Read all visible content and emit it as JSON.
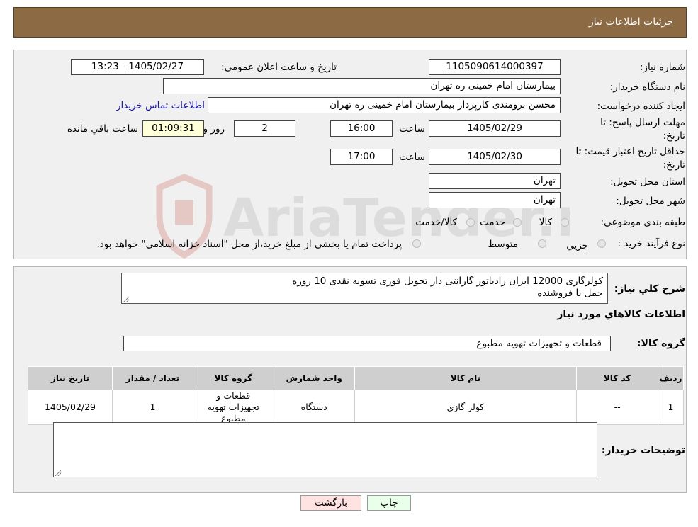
{
  "header": {
    "title": "جزئیات اطلاعات نیاز"
  },
  "watermark": {
    "text": "AriaTender.neT"
  },
  "form": {
    "need_number": {
      "label": "شماره نیاز:",
      "value": "1105090614000397"
    },
    "announce": {
      "label": "تاریخ و ساعت اعلان عمومی:",
      "value": "1405/02/27 - 13:23"
    },
    "buyer_org": {
      "label": "نام دستگاه خریدار:",
      "value": "بیمارستان امام خمینی ره  تهران"
    },
    "requester": {
      "label": "ایجاد کننده درخواست:",
      "value": "محسن برومندی کارپرداز بیمارستان امام خمینی ره  تهران",
      "contact_link": "اطلاعات تماس خریدار"
    },
    "reply_deadline": {
      "label_line1": "مهلت ارسال پاسخ: تا",
      "label_line2": "تاریخ:",
      "date": "1405/02/29",
      "time_label": "ساعت",
      "time": "16:00",
      "days": "2",
      "days_label": "روز و",
      "remaining": "01:09:31",
      "remaining_label": "ساعت باقي مانده"
    },
    "price_validity": {
      "label_line1": "حداقل تاریخ اعتبار قیمت: تا",
      "label_line2": "تاریخ:",
      "date": "1405/02/30",
      "time_label": "ساعت",
      "time": "17:00"
    },
    "province": {
      "label": "استان محل تحویل:",
      "value": "تهران"
    },
    "city": {
      "label": "شهر محل تحویل:",
      "value": "تهران"
    },
    "category": {
      "label": "طبقه بندی موضوعی:",
      "options": [
        "کالا",
        "خدمت",
        "کالا/خدمت"
      ]
    },
    "purchase_type": {
      "label": "نوع فرآیند خرید :",
      "options": [
        "جزیي",
        "متوسط"
      ],
      "note": "پرداخت تمام یا بخشی از مبلغ خرید،از محل \"اسناد خزانه اسلامی\" خواهد بود."
    }
  },
  "details": {
    "description_label": "شرح کلي نياز:",
    "description_line1": "کولرگازی 12000 ایران رادیاتور گارانتی دار تحویل فوری تسویه نقدی 10 روزه",
    "description_line2": "حمل با فروشنده",
    "goods_heading": "اطلاعات کالاهاي مورد نياز",
    "goods_group_label": "گروه کالا:",
    "goods_group_value": "قطعات و تجهیزات تهویه مطبوع",
    "table": {
      "headers": [
        "ردیف",
        "کد کالا",
        "نام کالا",
        "واحد شمارش",
        "گروه کالا",
        "تعداد / مقدار",
        "تاریخ نیاز"
      ],
      "rows": [
        [
          "1",
          "--",
          "کولر گازی",
          "دستگاه",
          "قطعات و تجهیزات تهویه مطبوع",
          "1",
          "1405/02/29"
        ]
      ]
    },
    "buyer_notes_label": "توضیحات خریدار:"
  },
  "buttons": {
    "print": "چاپ",
    "back": "بازگشت"
  }
}
